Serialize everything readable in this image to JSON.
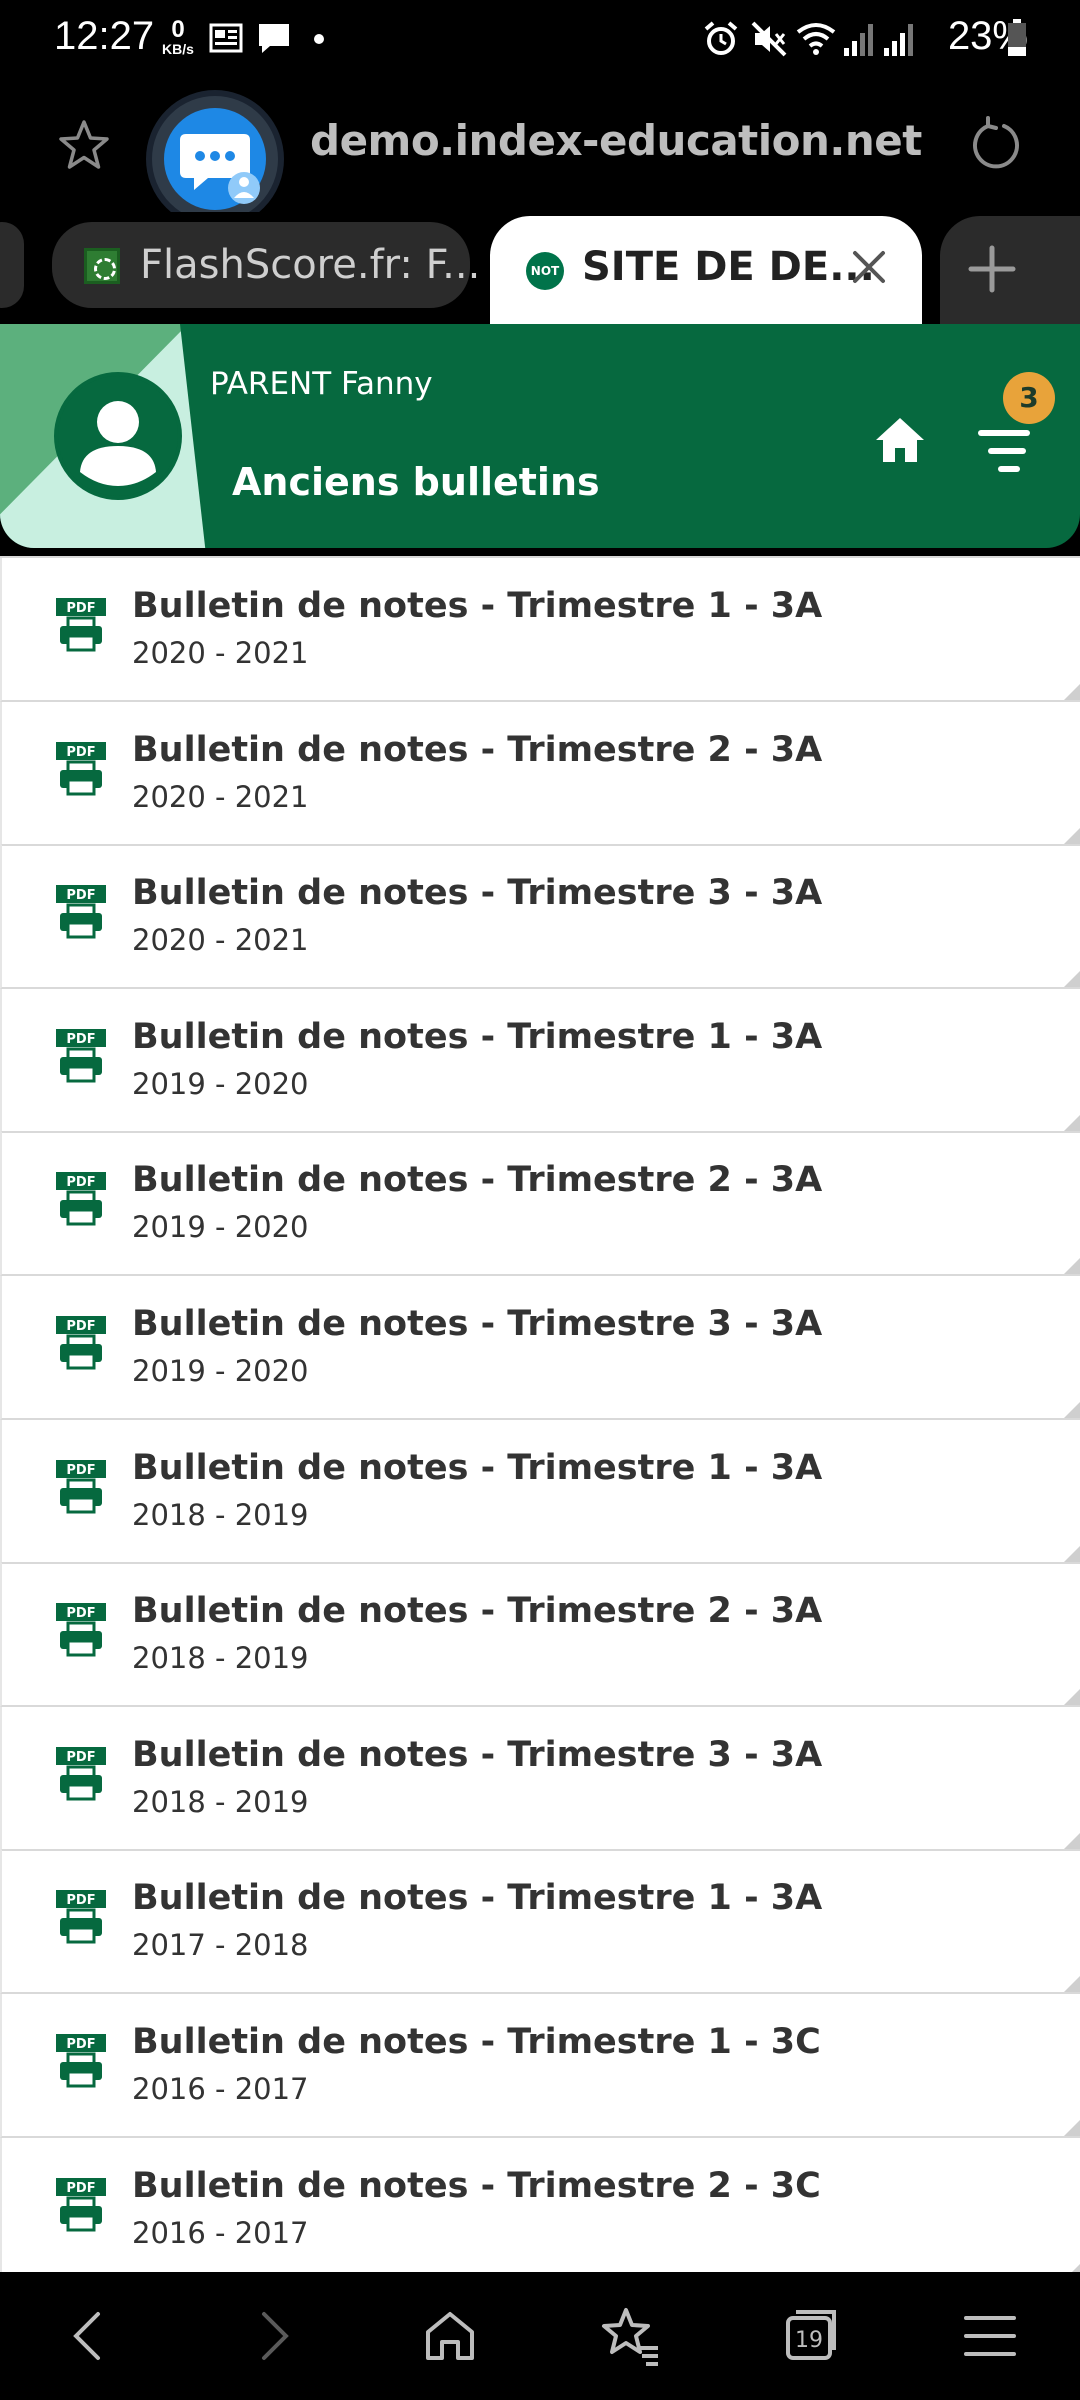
{
  "status_bar": {
    "time": "12:27",
    "net_speed": "0",
    "net_unit": "KB/s",
    "battery": "23%"
  },
  "browser": {
    "url": "demo.index-education.net",
    "tabs": [
      {
        "label": "FlashScore.fr: F...",
        "active": false
      },
      {
        "label": "SITE DE DE...",
        "active": true,
        "favicon_text": "NOT"
      }
    ],
    "bottom_nav": {
      "tab_count": "19"
    }
  },
  "header": {
    "user_name": "PARENT Fanny",
    "page_title": "Anciens bulletins",
    "notification_count": "3",
    "colors": {
      "primary": "#06693f",
      "accent": "#e8a33a"
    }
  },
  "list": {
    "pdf_badge": "PDF",
    "items": [
      {
        "title": "Bulletin de notes - Trimestre 1 - 3A",
        "year": "2020 - 2021"
      },
      {
        "title": "Bulletin de notes - Trimestre 2 - 3A",
        "year": "2020 - 2021"
      },
      {
        "title": "Bulletin de notes - Trimestre 3 - 3A",
        "year": "2020 - 2021"
      },
      {
        "title": "Bulletin de notes - Trimestre 1 - 3A",
        "year": "2019 - 2020"
      },
      {
        "title": "Bulletin de notes - Trimestre 2 - 3A",
        "year": "2019 - 2020"
      },
      {
        "title": "Bulletin de notes - Trimestre 3 - 3A",
        "year": "2019 - 2020"
      },
      {
        "title": "Bulletin de notes - Trimestre 1 - 3A",
        "year": "2018 - 2019"
      },
      {
        "title": "Bulletin de notes - Trimestre 2 - 3A",
        "year": "2018 - 2019"
      },
      {
        "title": "Bulletin de notes - Trimestre 3 - 3A",
        "year": "2018 - 2019"
      },
      {
        "title": "Bulletin de notes - Trimestre 1 - 3A",
        "year": "2017 - 2018"
      },
      {
        "title": "Bulletin de notes - Trimestre 1 - 3C",
        "year": "2016 - 2017"
      },
      {
        "title": "Bulletin de notes - Trimestre 2 - 3C",
        "year": "2016 - 2017"
      }
    ]
  }
}
